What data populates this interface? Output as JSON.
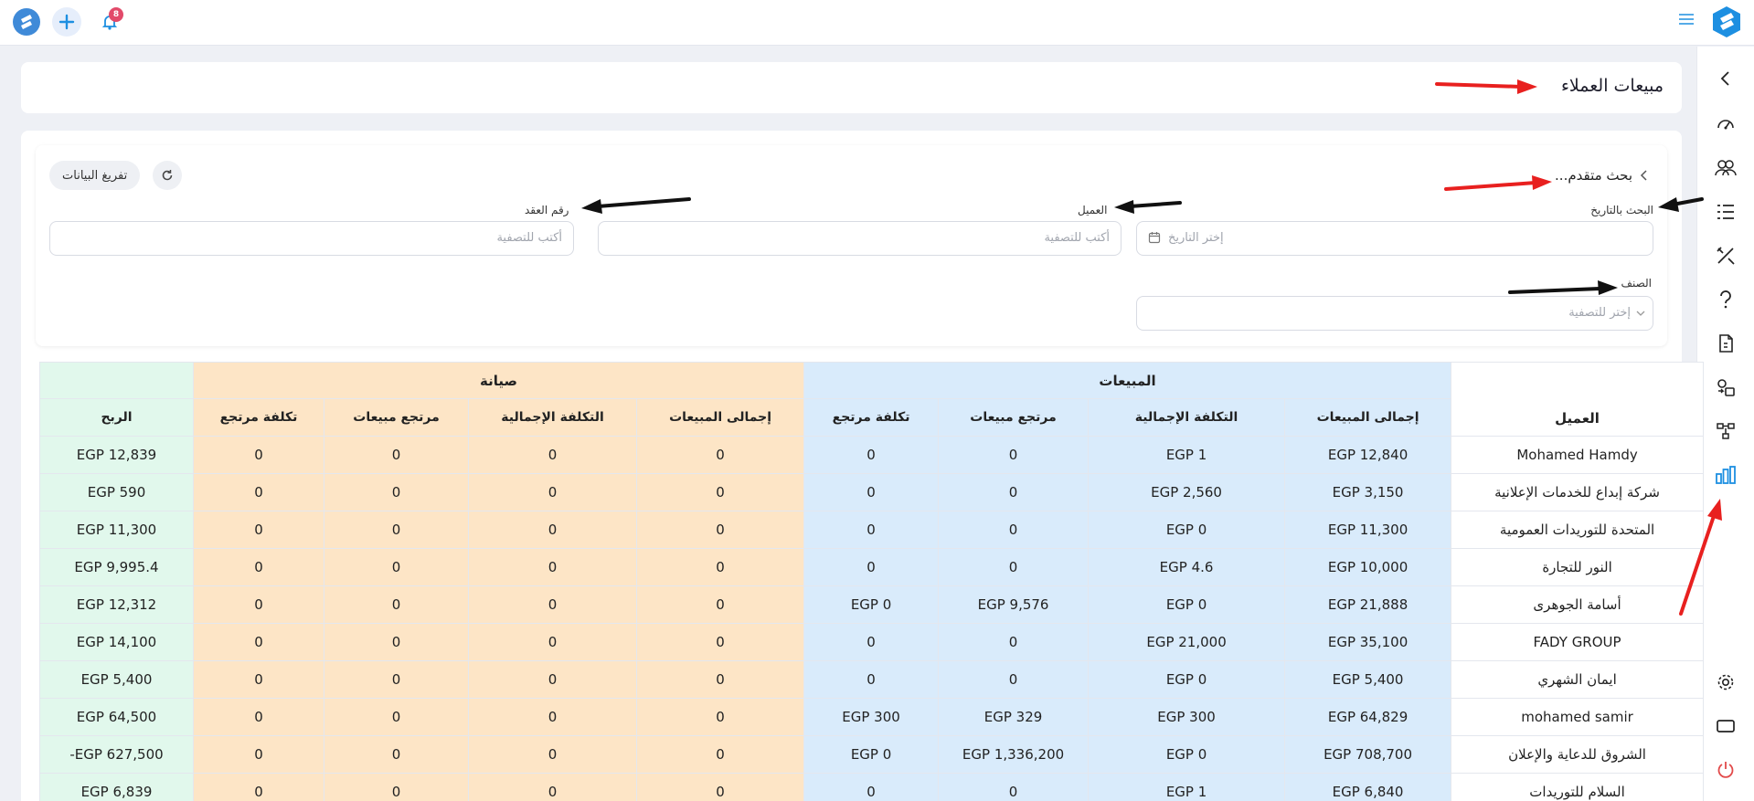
{
  "topbar": {
    "notification_count": "8",
    "logo_icon": "app-logo-icon",
    "add_icon": "plus-icon",
    "bell_icon": "bell-icon",
    "menu_icon": "hamburger-menu-icon"
  },
  "sidebar": {
    "items": [
      {
        "icon": "chevron-left-icon"
      },
      {
        "icon": "dashboard-gauge-icon"
      },
      {
        "icon": "users-icon"
      },
      {
        "icon": "list-icon"
      },
      {
        "icon": "tools-icon"
      },
      {
        "icon": "question-icon"
      },
      {
        "icon": "document-dollar-icon"
      },
      {
        "icon": "transfer-icon"
      },
      {
        "icon": "hierarchy-icon"
      },
      {
        "icon": "bar-chart-icon",
        "active": true
      },
      {
        "icon": "gear-icon"
      },
      {
        "icon": "screen-icon"
      },
      {
        "icon": "power-icon"
      }
    ]
  },
  "page": {
    "title": "مبيعات العملاء"
  },
  "filters": {
    "advanced_search": "بحث متقدم...",
    "export_label": "تفريغ البيانات",
    "date_label": "البحث بالتاريخ",
    "date_placeholder": "إختر التاريخ",
    "client_label": "العميل",
    "client_placeholder": "أكتب للتصفية",
    "contract_label": "رقم العقد",
    "contract_placeholder": "أكتب للتصفية",
    "category_label": "الصنف",
    "category_placeholder": "إختر للتصفية"
  },
  "table": {
    "client_header": "العميل",
    "sales_group": "المبيعات",
    "maintenance_group": "صيانة",
    "profit_header": "الربح",
    "sub_headers": {
      "total_sales": "إجمالى المبيعات",
      "total_cost": "التكلفة الإجمالية",
      "sales_return": "مرتجع مبيعات",
      "return_cost": "تكلفة مرتجع"
    },
    "rows": [
      {
        "client": "Mohamed Hamdy",
        "s_total": "EGP 12,840",
        "s_cost": "EGP 1",
        "s_ret": "0",
        "s_ret_cost": "0",
        "m_total": "0",
        "m_cost": "0",
        "m_ret": "0",
        "m_ret_cost": "0",
        "profit": "EGP 12,839"
      },
      {
        "client": "شركة إبداع للخدمات الإعلانية",
        "s_total": "EGP 3,150",
        "s_cost": "EGP 2,560",
        "s_ret": "0",
        "s_ret_cost": "0",
        "m_total": "0",
        "m_cost": "0",
        "m_ret": "0",
        "m_ret_cost": "0",
        "profit": "EGP 590"
      },
      {
        "client": "المتحدة للتوريدات العمومية",
        "s_total": "EGP 11,300",
        "s_cost": "EGP 0",
        "s_ret": "0",
        "s_ret_cost": "0",
        "m_total": "0",
        "m_cost": "0",
        "m_ret": "0",
        "m_ret_cost": "0",
        "profit": "EGP 11,300"
      },
      {
        "client": "النور للتجارة",
        "s_total": "EGP 10,000",
        "s_cost": "EGP 4.6",
        "s_ret": "0",
        "s_ret_cost": "0",
        "m_total": "0",
        "m_cost": "0",
        "m_ret": "0",
        "m_ret_cost": "0",
        "profit": "EGP 9,995.4"
      },
      {
        "client": "أسامة الجوهرى",
        "s_total": "EGP 21,888",
        "s_cost": "EGP 0",
        "s_ret": "EGP 9,576",
        "s_ret_cost": "EGP 0",
        "m_total": "0",
        "m_cost": "0",
        "m_ret": "0",
        "m_ret_cost": "0",
        "profit": "EGP 12,312"
      },
      {
        "client": "FADY GROUP",
        "s_total": "EGP 35,100",
        "s_cost": "EGP 21,000",
        "s_ret": "0",
        "s_ret_cost": "0",
        "m_total": "0",
        "m_cost": "0",
        "m_ret": "0",
        "m_ret_cost": "0",
        "profit": "EGP 14,100"
      },
      {
        "client": "ايمان الشهري",
        "s_total": "EGP 5,400",
        "s_cost": "EGP 0",
        "s_ret": "0",
        "s_ret_cost": "0",
        "m_total": "0",
        "m_cost": "0",
        "m_ret": "0",
        "m_ret_cost": "0",
        "profit": "EGP 5,400"
      },
      {
        "client": "mohamed samir",
        "s_total": "EGP 64,829",
        "s_cost": "EGP 300",
        "s_ret": "EGP 329",
        "s_ret_cost": "EGP 300",
        "m_total": "0",
        "m_cost": "0",
        "m_ret": "0",
        "m_ret_cost": "0",
        "profit": "EGP 64,500"
      },
      {
        "client": "الشروق للدعاية والإعلان",
        "s_total": "EGP 708,700",
        "s_cost": "EGP 0",
        "s_ret": "EGP 1,336,200",
        "s_ret_cost": "EGP 0",
        "m_total": "0",
        "m_cost": "0",
        "m_ret": "0",
        "m_ret_cost": "0",
        "profit": "EGP 627,500-"
      },
      {
        "client": "السلام للتوريدات",
        "s_total": "EGP 6,840",
        "s_cost": "EGP 1",
        "s_ret": "0",
        "s_ret_cost": "0",
        "m_total": "0",
        "m_cost": "0",
        "m_ret": "0",
        "m_ret_cost": "0",
        "profit": "EGP 6,839"
      }
    ]
  },
  "colors": {
    "accent": "#1d8fe1",
    "sales_bg": "#d9ebfb",
    "maintenance_bg": "#fde5c6",
    "profit_bg": "#e1f8ec",
    "badge": "#e24a6a"
  }
}
